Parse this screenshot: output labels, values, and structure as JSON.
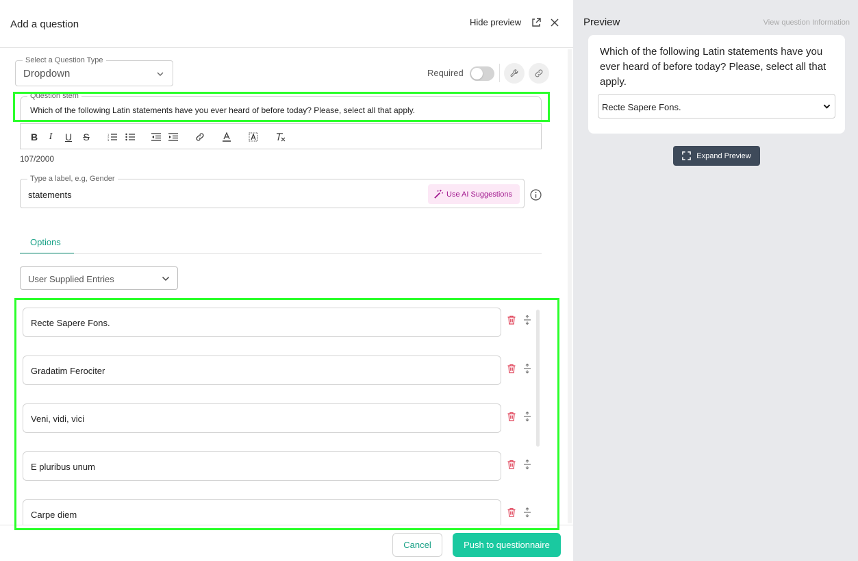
{
  "header": {
    "title": "Add a question",
    "hide_preview": "Hide preview"
  },
  "question_type": {
    "label": "Select a Question Type",
    "value": "Dropdown"
  },
  "required": {
    "label": "Required",
    "enabled": false
  },
  "question_stem": {
    "label": "Question stem",
    "value": "Which of the following Latin statements have you ever heard of before today? Please, select all that apply.",
    "counter": "107/2000"
  },
  "formatting_tools": [
    "bold-icon",
    "italic-icon",
    "underline-icon",
    "strikethrough-icon",
    "ordered-list-icon",
    "bullet-list-icon",
    "outdent-icon",
    "indent-icon",
    "link-icon",
    "text-color-icon",
    "highlight-icon",
    "clear-format-icon"
  ],
  "label_field": {
    "label": "Type a label, e.g, Gender",
    "value": "statements",
    "ai_button": "Use AI Suggestions"
  },
  "tabs": {
    "options": "Options"
  },
  "entries_dropdown": {
    "value": "User Supplied Entries"
  },
  "options": [
    "Recte Sapere Fons.",
    "Gradatim Ferociter",
    "Veni, vidi, vici",
    "E pluribus unum",
    "Carpe diem"
  ],
  "footer": {
    "cancel": "Cancel",
    "push": "Push to questionnaire"
  },
  "preview": {
    "title": "Preview",
    "view_info": "View question Information",
    "question": "Which of the following Latin statements have you ever heard of before today? Please, select all that apply.",
    "selected_option": "Recte Sapere Fons.",
    "expand_button": "Expand Preview"
  },
  "colors": {
    "accent": "#16a085",
    "primary_button": "#1ac9a0",
    "ai_text": "#a0168d",
    "trash": "#e0455b",
    "highlight": "#2bff2b"
  }
}
